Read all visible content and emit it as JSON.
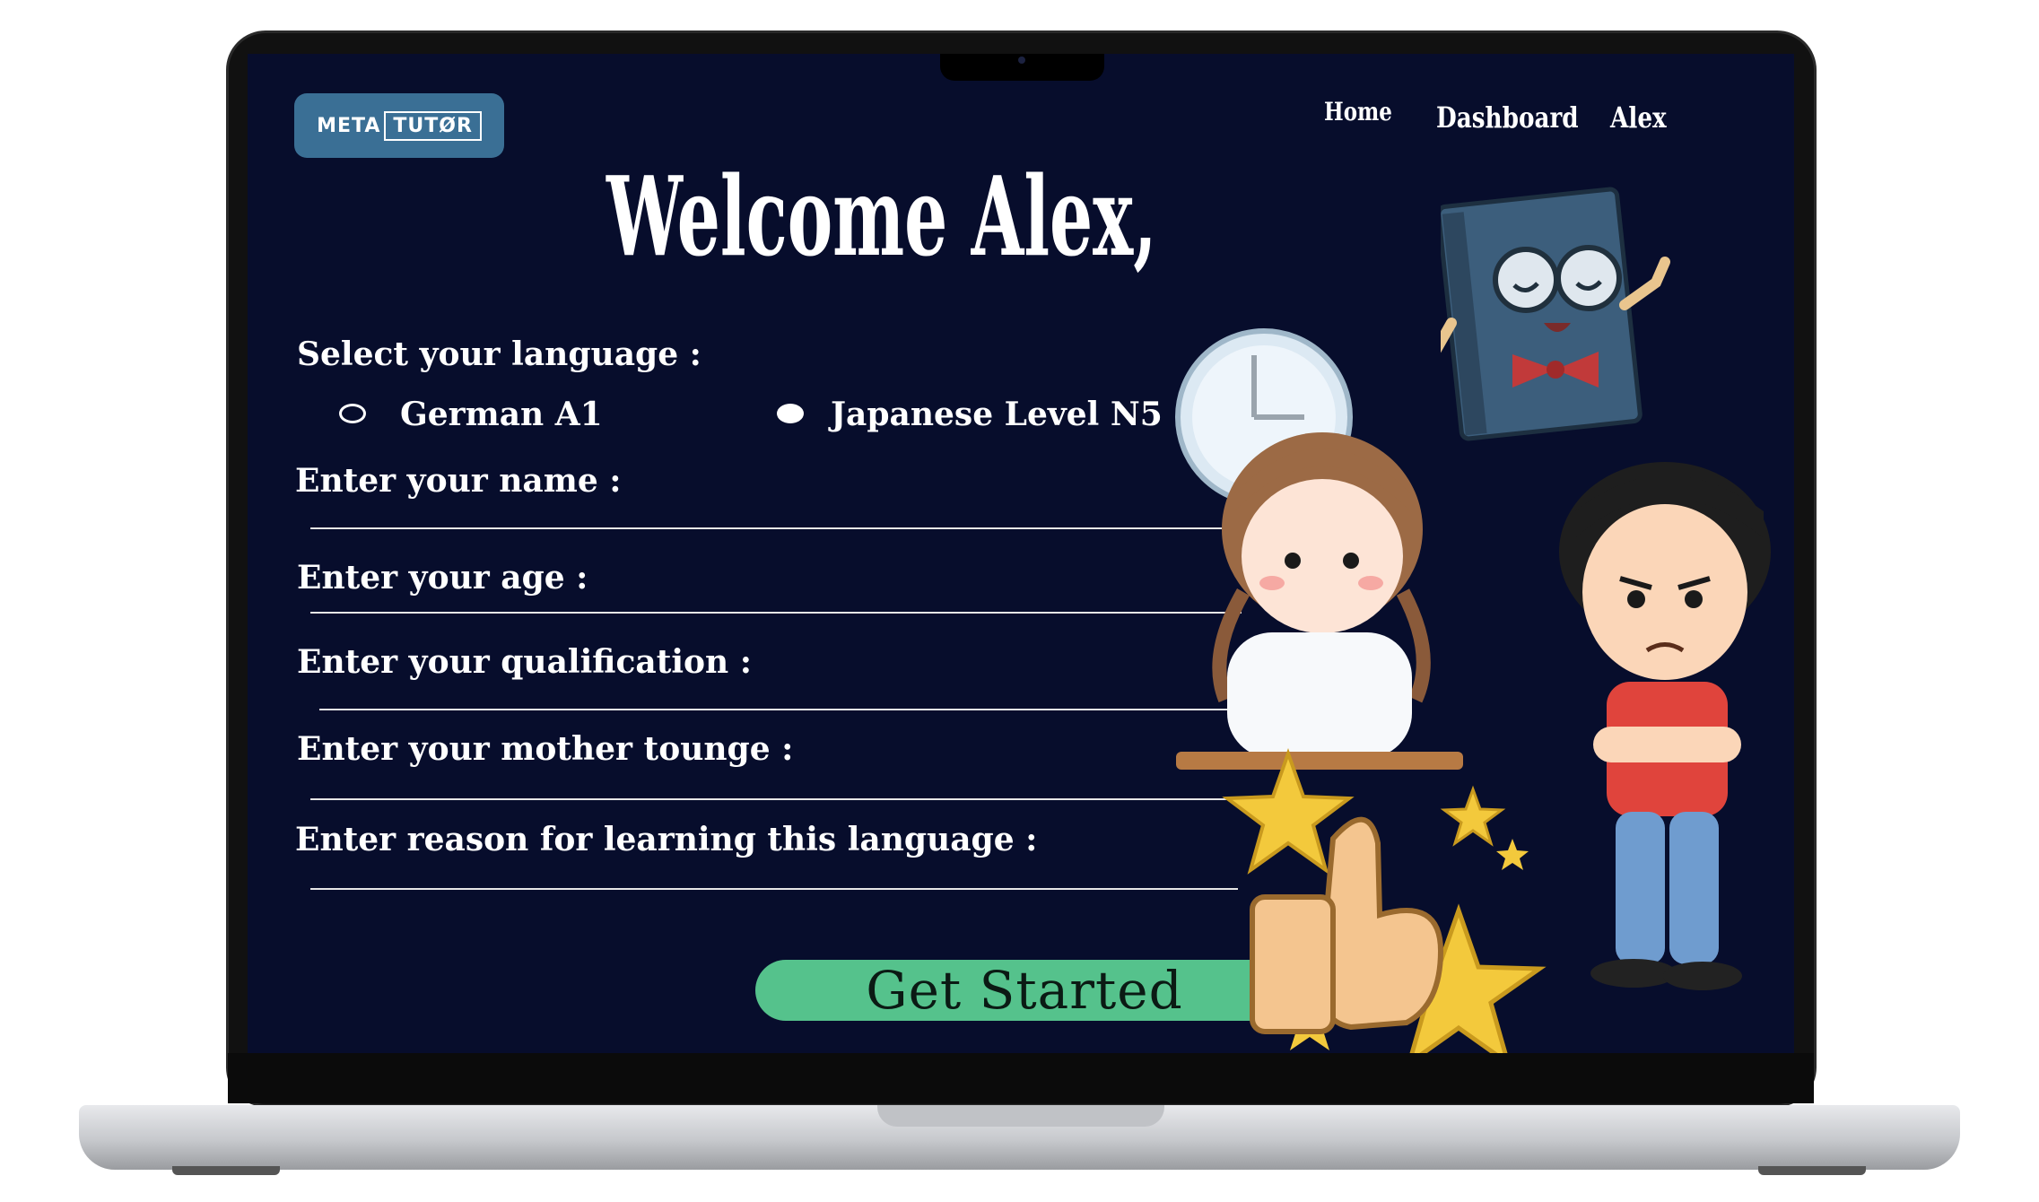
{
  "header": {
    "logo_left": "META",
    "logo_right": "TUTØR",
    "nav": [
      {
        "label": "Home"
      },
      {
        "label": "Dashboard"
      },
      {
        "label": "Alex"
      }
    ]
  },
  "main": {
    "title": "Welcome Alex,",
    "language_label": "Select your language :",
    "languages": [
      {
        "label": "German A1",
        "selected": false
      },
      {
        "label": "Japanese Level N5",
        "selected": true
      }
    ],
    "fields": [
      {
        "label": "Enter your name :",
        "value": ""
      },
      {
        "label": "Enter your age :",
        "value": ""
      },
      {
        "label": "Enter your qualification :",
        "value": ""
      },
      {
        "label": "Enter your mother tounge :",
        "value": ""
      },
      {
        "label": "Enter reason for learning this language :",
        "value": ""
      }
    ],
    "cta_label": "Get Started"
  },
  "illustrations": [
    "clock-illustration",
    "book-character-illustration",
    "girl-thinking-illustration",
    "angry-boy-illustration",
    "thumbs-up-stars-illustration"
  ],
  "colors": {
    "background": "#070d2c",
    "logo": "#3a6f95",
    "cta": "#55c28c",
    "text": "#ffffff"
  }
}
